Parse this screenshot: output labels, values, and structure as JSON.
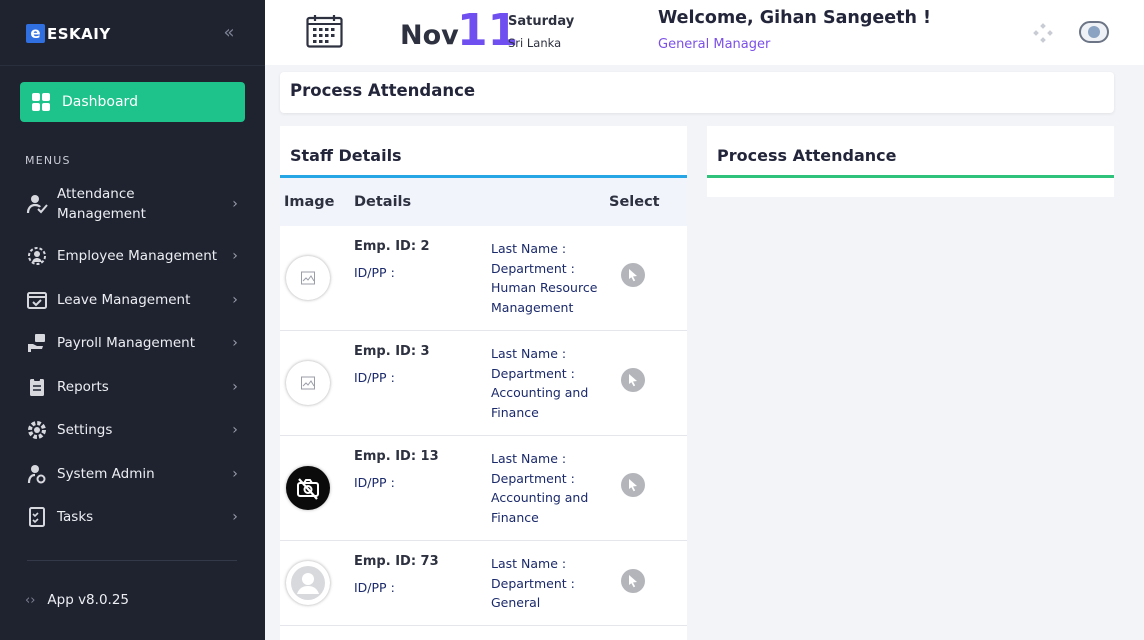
{
  "sidebar": {
    "logo_letter": "e",
    "logo_text": "ESKAIY",
    "dashboard_label": "Dashboard",
    "menus_label": "MENUS",
    "items": [
      {
        "label": "Attendance Management",
        "icon": "user-check-icon"
      },
      {
        "label": "Employee Management",
        "icon": "users-gear-icon"
      },
      {
        "label": "Leave Management",
        "icon": "calendar-check-icon"
      },
      {
        "label": "Payroll Management",
        "icon": "hand-money-icon"
      },
      {
        "label": "Reports",
        "icon": "clipboard-icon"
      },
      {
        "label": "Settings",
        "icon": "gear-icon"
      },
      {
        "label": "System Admin",
        "icon": "user-cog-icon"
      },
      {
        "label": "Tasks",
        "icon": "task-list-icon"
      }
    ],
    "version": "App v8.0.25"
  },
  "header": {
    "month": "Nov",
    "day": "11",
    "weekday": "Saturday",
    "country": "Sri Lanka",
    "welcome": "Welcome, Gihan Sangeeth !",
    "role": "General Manager"
  },
  "page_title": "Process Attendance",
  "staff": {
    "title": "Staff Details",
    "columns": {
      "image": "Image",
      "details": "Details",
      "select": "Select"
    },
    "rows": [
      {
        "emp_id": "Emp. ID: 2",
        "idpp": "ID/PP :",
        "last_name": "Last Name :",
        "department_label": "Department :",
        "department": "Human Resource Management",
        "image": "broken-image-icon"
      },
      {
        "emp_id": "Emp. ID: 3",
        "idpp": "ID/PP :",
        "last_name": "Last Name :",
        "department_label": "Department :",
        "department": "Accounting and Finance",
        "image": "broken-image-icon"
      },
      {
        "emp_id": "Emp. ID: 13",
        "idpp": "ID/PP :",
        "last_name": "Last Name :",
        "department_label": "Department :",
        "department": "Accounting and Finance",
        "image": "no-camera-icon"
      },
      {
        "emp_id": "Emp. ID: 73",
        "idpp": "ID/PP :",
        "last_name": "Last Name :",
        "department_label": "Department :",
        "department": "General",
        "image": "default-avatar-icon"
      }
    ]
  },
  "process_panel": {
    "title": "Process Attendance"
  },
  "colors": {
    "sidebar_bg": "#1f2330",
    "accent_green": "#1ec28b",
    "date_purple": "#6f4ff0",
    "staff_border": "#27a6e5",
    "process_border": "#2fc27a"
  }
}
